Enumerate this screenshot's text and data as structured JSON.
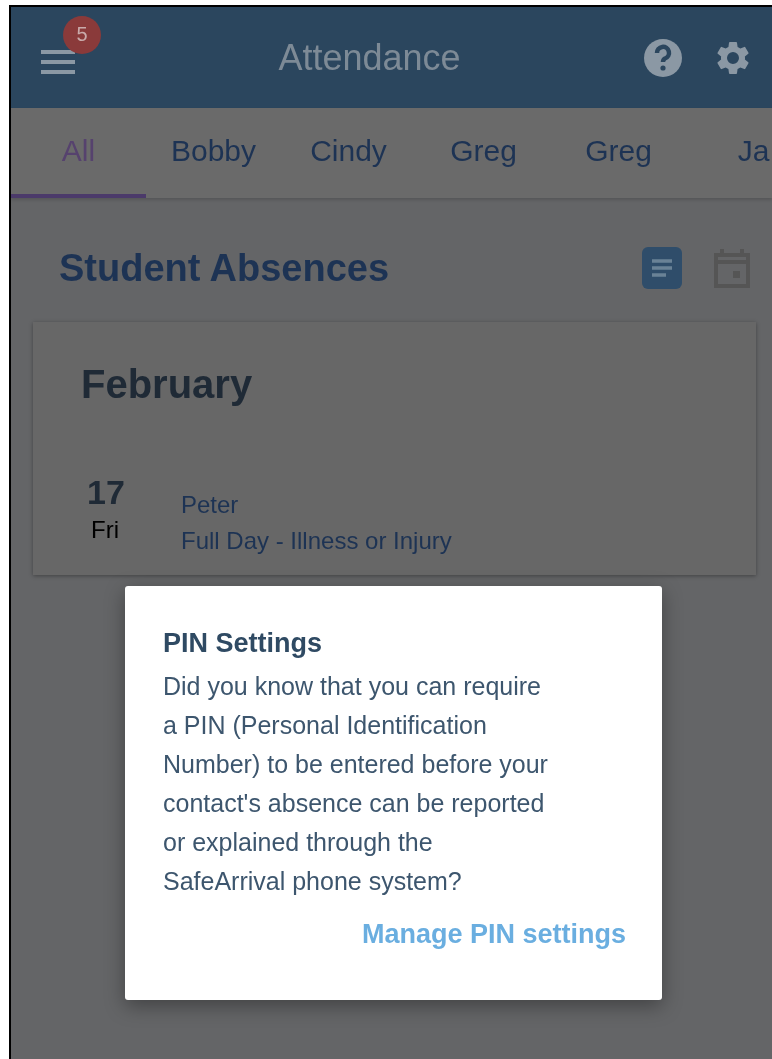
{
  "header": {
    "title": "Attendance",
    "menu_badge": "5"
  },
  "tabs": [
    {
      "label": "All",
      "selected": true
    },
    {
      "label": "Bobby",
      "selected": false
    },
    {
      "label": "Cindy",
      "selected": false
    },
    {
      "label": "Greg",
      "selected": false
    },
    {
      "label": "Greg",
      "selected": false
    },
    {
      "label": "Ja",
      "selected": false
    }
  ],
  "section": {
    "title": "Student Absences",
    "views": [
      {
        "kind": "list",
        "selected": true
      },
      {
        "kind": "calendar",
        "selected": false
      }
    ]
  },
  "months": [
    {
      "name": "February",
      "absences": [
        {
          "day": "17",
          "weekday": "Fri",
          "student": "Peter",
          "reason": "Full Day - Illness or Injury"
        }
      ]
    }
  ],
  "dialog": {
    "title": "PIN Settings",
    "body": "Did you know that you can require a PIN (Personal Identification Number) to be entered before your contact's absence can be reported or explained through the SafeArrival phone system?",
    "action": "Manage PIN settings"
  }
}
